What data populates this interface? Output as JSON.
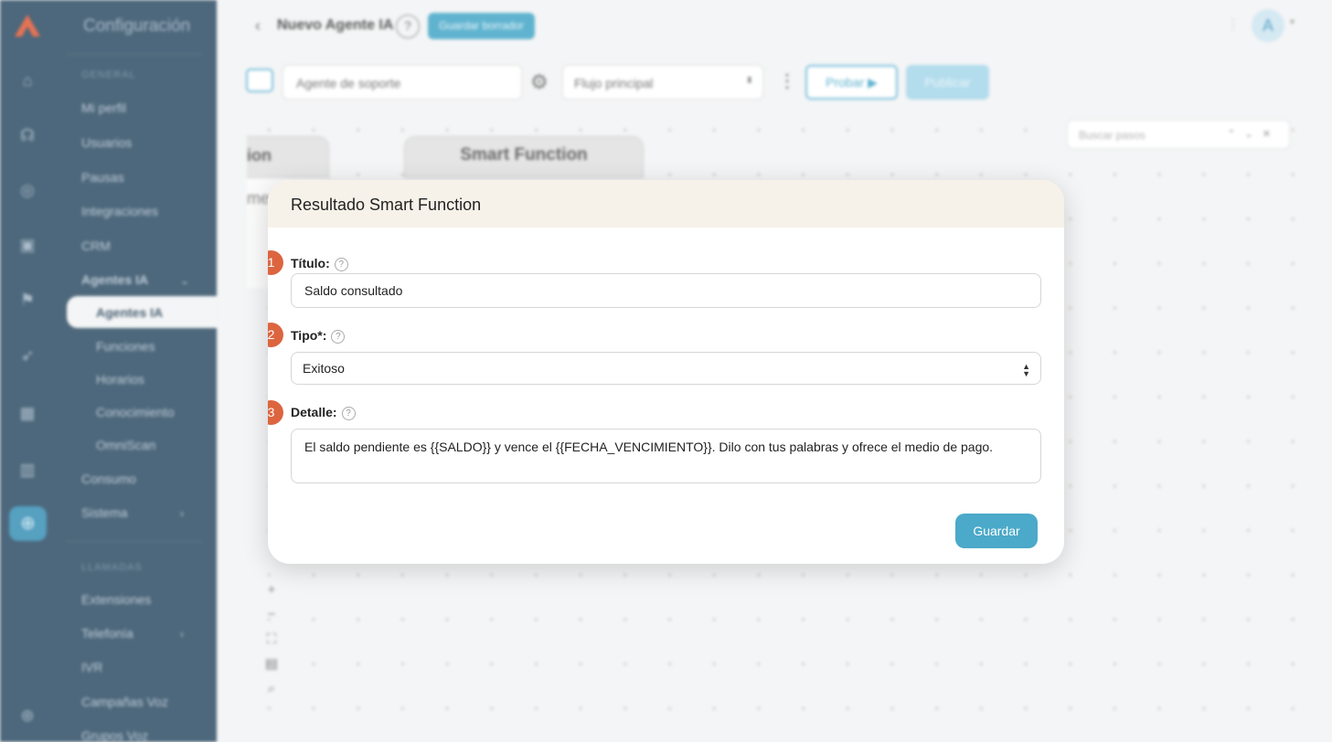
{
  "rail": {
    "icons": [
      "home-icon",
      "headset-icon",
      "chat-icon",
      "contacts-icon",
      "flag-icon",
      "rocket-icon",
      "calendar-icon",
      "chart-icon",
      "globe-icon",
      "globe-icon"
    ]
  },
  "sidebar": {
    "title": "Configuración",
    "section_general": "GENERAL",
    "items": {
      "mi_perfil": "Mi perfil",
      "usuarios": "Usuarios",
      "pausas": "Pausas",
      "integraciones": "Integraciones",
      "crm": "CRM",
      "agentes_ia": "Agentes IA",
      "agentes_ia_sub": "Agentes IA",
      "funciones": "Funciones",
      "horarios": "Horarios",
      "conocimiento": "Conocimiento",
      "omniscan": "OmniScan",
      "consumo": "Consumo",
      "sistema": "Sistema"
    },
    "section_llamadas": "LLAMADAS",
    "items2": {
      "extensiones": "Extensiones",
      "telefonia": "Telefonía",
      "ivr": "IVR",
      "campanas_voz": "Campañas Voz",
      "grupos_voz": "Grupos Voz"
    }
  },
  "topbar": {
    "agent_name": "Nuevo Agente IA",
    "help": "?",
    "draft_button": "Guardar borrador",
    "avatar": "A"
  },
  "toolbar": {
    "agent_field": "Agente de soporte",
    "flow_select": "Flujo principal",
    "test_button": "Probar",
    "publish_button": "Publicar"
  },
  "canvas": {
    "node_left_title": "ion",
    "node_left_body": "mer",
    "node_title": "Smart Function",
    "search_placeholder": "Buscar pasos"
  },
  "modal": {
    "title": "Resultado Smart Function",
    "fields": [
      {
        "step": "1",
        "label": "Título:",
        "value": "Saldo consultado"
      },
      {
        "step": "2",
        "label": "Tipo*:",
        "value": "Exitoso"
      },
      {
        "step": "3",
        "label": "Detalle:",
        "value": "El saldo pendiente es {{SALDO}} y vence el {{FECHA_VENCIMIENTO}}. Dilo con tus palabras y ofrece el medio de pago."
      }
    ],
    "save_button": "Guardar"
  }
}
